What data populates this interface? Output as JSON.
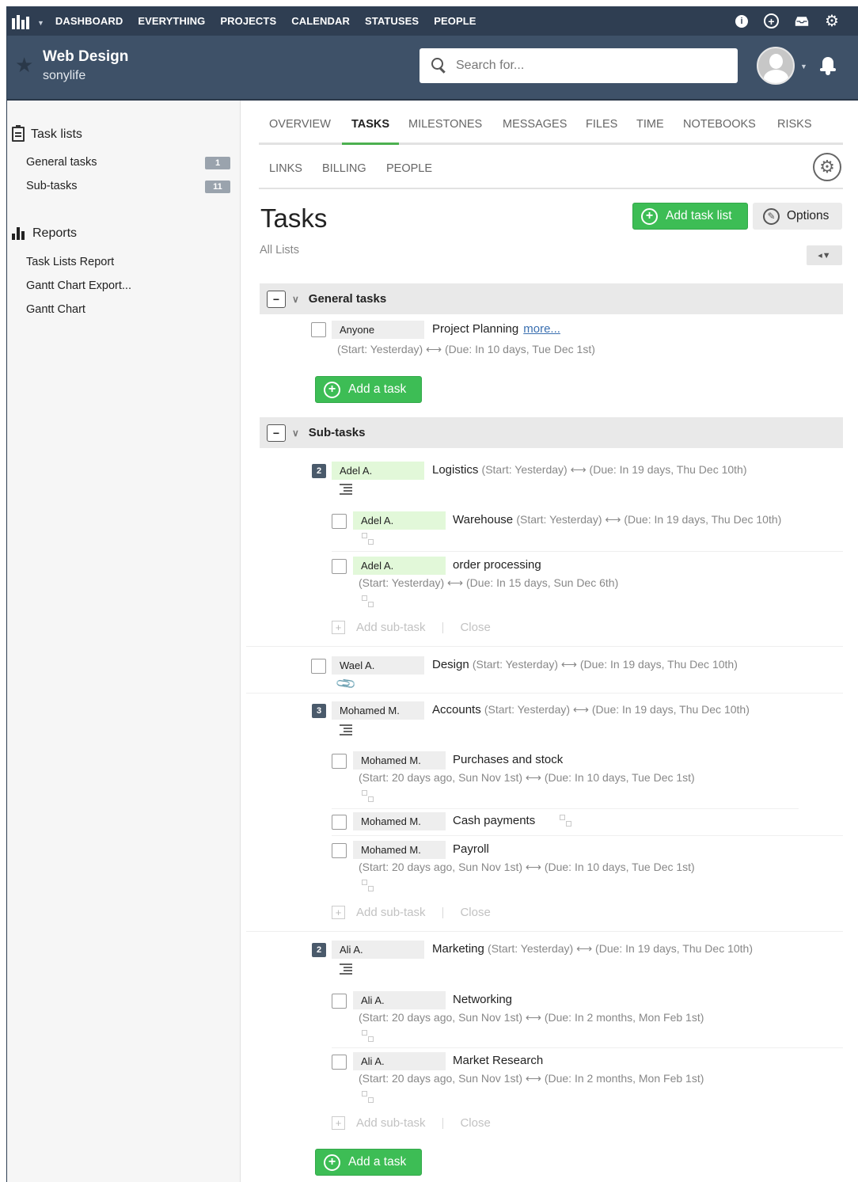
{
  "topnav": {
    "links": [
      "DASHBOARD",
      "EVERYTHING",
      "PROJECTS",
      "CALENDAR",
      "STATUSES",
      "PEOPLE"
    ],
    "icons": [
      "info-icon",
      "add-icon",
      "inbox-icon",
      "gear-icon"
    ]
  },
  "project": {
    "title": "Web Design",
    "subtitle": "sonylife"
  },
  "search": {
    "placeholder": "Search for..."
  },
  "sidebar": {
    "task_lists_heading": "Task lists",
    "task_lists": [
      {
        "label": "General tasks",
        "count": "1"
      },
      {
        "label": "Sub-tasks",
        "count": "11"
      }
    ],
    "reports_heading": "Reports",
    "reports": [
      "Task Lists Report",
      "Gantt Chart Export...",
      "Gantt Chart"
    ]
  },
  "tabs": {
    "primary": [
      "OVERVIEW",
      "TASKS",
      "MILESTONES",
      "MESSAGES",
      "FILES",
      "TIME",
      "NOTEBOOKS",
      "RISKS"
    ],
    "active": "TASKS",
    "secondary": [
      "LINKS",
      "BILLING",
      "PEOPLE"
    ]
  },
  "page": {
    "title": "Tasks",
    "filter_label": "All Lists",
    "add_task_list": "Add task list",
    "options": "Options",
    "add_task": "Add a task",
    "add_subtask": "Add sub-task",
    "close": "Close",
    "more": "more..."
  },
  "lists": {
    "general": {
      "name": "General tasks",
      "tasks": [
        {
          "assignee": "Anyone",
          "name": "Project Planning",
          "dates": "(Start: Yesterday) ⟷ (Due: In 10 days, Tue Dec 1st)"
        }
      ]
    },
    "sub": {
      "name": "Sub-tasks",
      "t_logistics": {
        "badge": "2",
        "assignee": "Adel A.",
        "name": "Logistics",
        "dates": "(Start: Yesterday) ⟷ (Due: In 19 days, Thu Dec 10th)"
      },
      "t_warehouse": {
        "assignee": "Adel A.",
        "name": "Warehouse",
        "dates": "(Start: Yesterday) ⟷ (Due: In 19 days, Thu Dec 10th)"
      },
      "t_order": {
        "assignee": "Adel A.",
        "name": "order processing",
        "dates": "(Start: Yesterday) ⟷ (Due: In 15 days, Sun Dec 6th)"
      },
      "t_design": {
        "assignee": "Wael A.",
        "name": "Design",
        "dates": "(Start: Yesterday) ⟷ (Due: In 19 days, Thu Dec 10th)"
      },
      "t_accounts": {
        "badge": "3",
        "assignee": "Mohamed M.",
        "name": "Accounts",
        "dates": "(Start: Yesterday) ⟷ (Due: In 19 days, Thu Dec 10th)"
      },
      "t_purchases": {
        "assignee": "Mohamed M.",
        "name": "Purchases and stock",
        "dates": "(Start: 20 days ago, Sun Nov 1st) ⟷ (Due: In 10 days, Tue Dec 1st)"
      },
      "t_cash": {
        "assignee": "Mohamed M.",
        "name": "Cash payments"
      },
      "t_payroll": {
        "assignee": "Mohamed M.",
        "name": "Payroll",
        "dates": "(Start: 20 days ago, Sun Nov 1st) ⟷ (Due: In 10 days, Tue Dec 1st)"
      },
      "t_marketing": {
        "badge": "2",
        "assignee": "Ali A.",
        "name": "Marketing",
        "dates": "(Start: Yesterday) ⟷ (Due: In 19 days, Thu Dec 10th)"
      },
      "t_networking": {
        "assignee": "Ali A.",
        "name": "Networking",
        "dates": "(Start: 20 days ago, Sun Nov 1st) ⟷ (Due: In 2 months, Mon Feb 1st)"
      },
      "t_research": {
        "assignee": "Ali A.",
        "name": "Market Research",
        "dates": "(Start: 20 days ago, Sun Nov 1st) ⟷ (Due: In 2 months, Mon Feb 1st)"
      }
    }
  },
  "colors": {
    "nav_bg": "#2f3e52",
    "header_bg": "#3e5168",
    "accent_green": "#3dbd55",
    "assignee_green": "#e2f8d9"
  }
}
